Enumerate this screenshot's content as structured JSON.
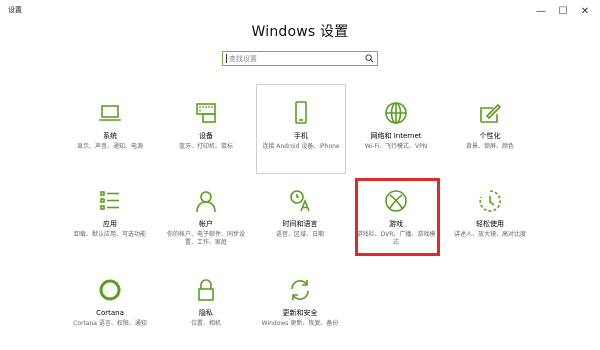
{
  "window": {
    "app_title": "设置",
    "minimize": "—",
    "maximize": "☐",
    "close": "✕"
  },
  "header": {
    "title": "Windows 设置"
  },
  "search": {
    "placeholder": "查找设置",
    "value": ""
  },
  "accent_color": "#5a9e1e",
  "highlight_color": "#e02a2a",
  "tiles": [
    {
      "icon": "laptop-icon",
      "label": "系统",
      "desc": "显示、声音、通知、电源"
    },
    {
      "icon": "keyboard-printer-icon",
      "label": "设备",
      "desc": "蓝牙、打印机、鼠标"
    },
    {
      "icon": "phone-icon",
      "label": "手机",
      "desc": "连接 Android 设备、iPhone"
    },
    {
      "icon": "globe-icon",
      "label": "网络和 Internet",
      "desc": "Wi-Fi、飞行模式、VPN"
    },
    {
      "icon": "paint-pen-icon",
      "label": "个性化",
      "desc": "背景、锁屏、颜色"
    },
    {
      "icon": "apps-list-icon",
      "label": "应用",
      "desc": "卸载、默认应用、可选功能"
    },
    {
      "icon": "person-icon",
      "label": "帐户",
      "desc": "你的帐户、电子邮件、同步设置、工作、家庭"
    },
    {
      "icon": "time-language-icon",
      "label": "时间和语言",
      "desc": "语音、区域、日期"
    },
    {
      "icon": "xbox-icon",
      "label": "游戏",
      "desc": "游戏栏、DVR、广播、游戏模式"
    },
    {
      "icon": "ease-of-access-icon",
      "label": "轻松使用",
      "desc": "讲述人、放大镜、高对比度"
    },
    {
      "icon": "cortana-icon",
      "label": "Cortana",
      "desc": "Cortana 语言、权限、通知"
    },
    {
      "icon": "lock-icon",
      "label": "隐私",
      "desc": "位置、相机"
    },
    {
      "icon": "sync-icon",
      "label": "更新和安全",
      "desc": "Windows 更新、恢复、备份"
    }
  ]
}
